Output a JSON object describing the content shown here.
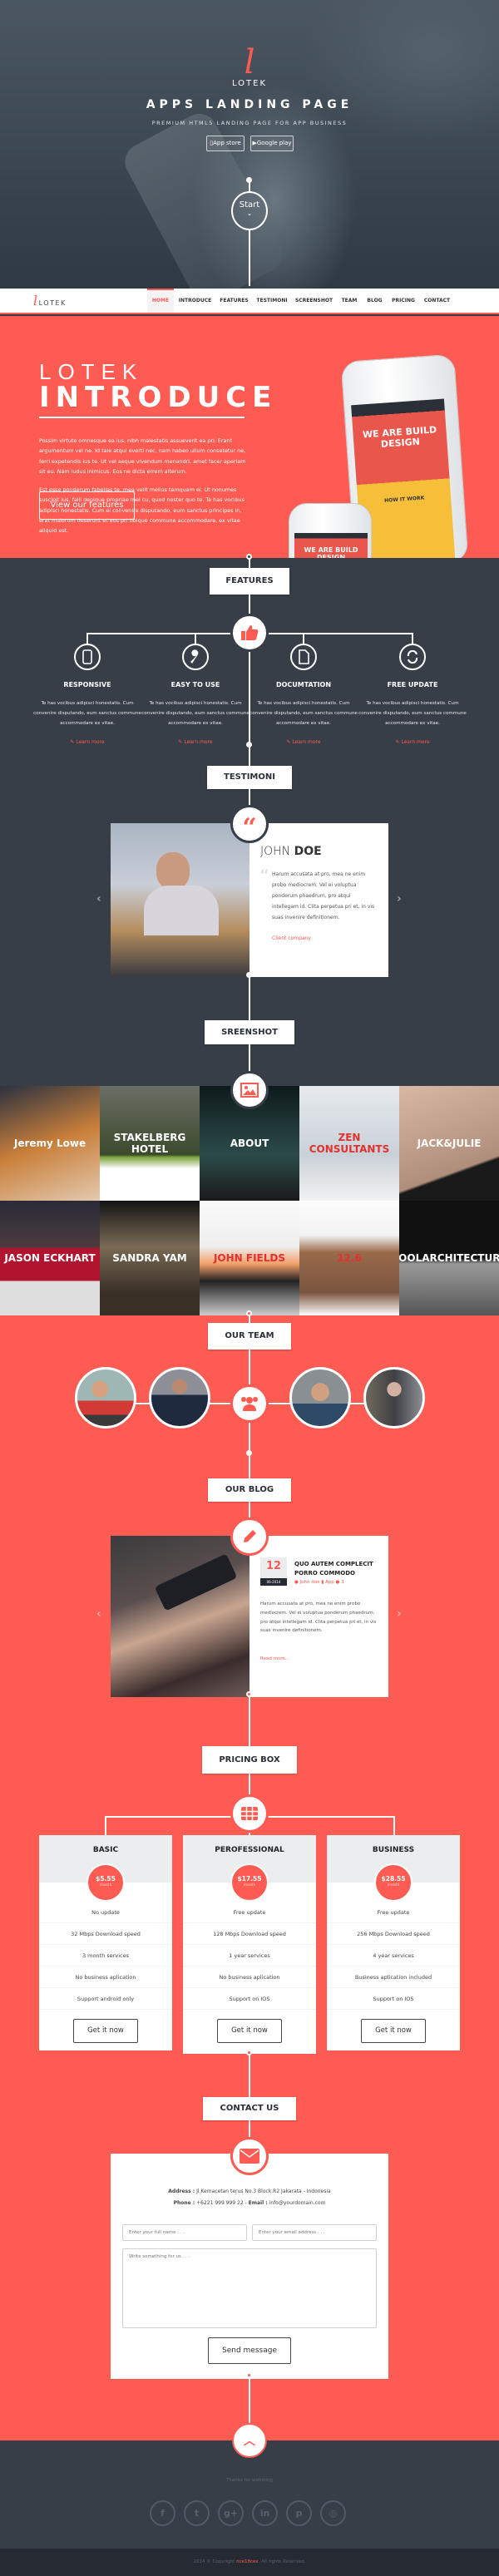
{
  "colors": {
    "accent": "#fe5b52",
    "dark": "#373e48",
    "footer_bar": "#262b33"
  },
  "hero": {
    "logo_letter": "l",
    "logo_text": "LOTEK",
    "title": "APPS LANDING PAGE",
    "subtitle": "PREMIUM HTML5 LANDING PAGE FOR APP BUSINESS",
    "app_store": "App store",
    "google_play": "Google play",
    "start": "Start"
  },
  "nav": {
    "logo_letter": "l",
    "logo_text": "LOTEK",
    "items": [
      {
        "label": "HOME",
        "active": true
      },
      {
        "label": "INTRODUCE"
      },
      {
        "label": "FEATURES"
      },
      {
        "label": "TESTIMONI"
      },
      {
        "label": "SCREENSHOT"
      },
      {
        "label": "TEAM"
      },
      {
        "label": "BLOG"
      },
      {
        "label": "PRICING"
      },
      {
        "label": "CONTACT"
      }
    ]
  },
  "intro": {
    "kicker": "LOTEK",
    "title": "INTRODUCE",
    "p1": "Possim virtute omnesque ea ius, nibh maiestatis assueverit ea pri. Erant argumentum vel ne. Id tale atqui everti nec, nam habeo ullum consetetur ne, ferri expetendis ius te. Ut vel aeque vivendum menandri, amet facer aperiam sit eu. Nam ludus inimicus. Eos ne dicta errem alterum.",
    "p2": "Est esse ponderum fabellas te, mea velit melius tamquam ei. Ut nonumes suscipit ius, falli denique propriae mel cu, quod noster quo te. Te has vocibus adipisci honestatis. Cum ei convenire disputando, eum sanctus principes in, erat malorum deserunt et eos pri tibique commune accommodare, ex vitae aliquid est.",
    "button": "View our features",
    "phone_screen": "WE ARE BUILD DESIGN",
    "phone_sub": "HOW IT WORK"
  },
  "features": {
    "heading": "FEATURES",
    "items": [
      {
        "icon": "tablet-icon",
        "title": "RESPONSIVE",
        "text": "Te has vocibus adipisci honestatis. Cum convenire disputando, eum sanctus commune accommodare ex vitae.",
        "link": "Learn more"
      },
      {
        "icon": "wrench-icon",
        "title": "EASY TO USE",
        "text": "Te has vocibus adipisci honestatis. Cum convenire disputando, eum sanctus commune accommodare ex vitae.",
        "link": "Learn more"
      },
      {
        "icon": "document-icon",
        "title": "DOCUMTATION",
        "text": "Te has vocibus adipisci honestatis. Cum convenire disputando, eum sanctus commune accommodare ex vitae.",
        "link": "Learn more"
      },
      {
        "icon": "refresh-icon",
        "title": "FREE UPDATE",
        "text": "Te has vocibus adipisci honestatis. Cum convenire disputando, eum sanctus commune accommodare ex vitae.",
        "link": "Learn more"
      }
    ]
  },
  "testimoni": {
    "heading": "TESTIMONI",
    "first_name": "JOHN",
    "last_name": "DOE",
    "quote": "Harum accusata at pro, mea ne enim probo mediocrem. Vel ei voluptua ponderum phaedrum, pro atqui intellegam id. Clita perpetua pri et, in vis suas invenire definitionem.",
    "company": "Client company"
  },
  "screenshot": {
    "heading": "SREENSHOT",
    "tiles": [
      "Jeremy Lowe",
      "STAKELBERG HOTEL",
      "ABOUT",
      "ZEN CONSULTANTS",
      "JACK&JULIE",
      "JASON ECKHART",
      "SANDRA YAM",
      "JOHN FIELDS",
      "12.6",
      "COOLARCHITECTURE"
    ]
  },
  "team": {
    "heading": "OUR TEAM"
  },
  "blog": {
    "heading": "OUR BLOG",
    "day": "12",
    "month_year": "06-2014",
    "title": "QUO AUTEM COMPLECIT PORRO COMMODO",
    "author": "John doe",
    "category": "App",
    "comments": "3",
    "text": "Harum accusata at pro, mea ne enim probo mediocrem. Vel ei voluptua ponderum phaedrum, pro atqui intellegam id. Clita perpetua pri et, in vis suas invenire definitionem.",
    "read_more": "Read more..."
  },
  "pricing": {
    "heading": "PRICING BOX",
    "plans": [
      {
        "name": "BASIC",
        "price": "$5.55",
        "period": "/month",
        "features": [
          "No update",
          "32 Mbps Download speed",
          "3 month services",
          "No business aplication",
          "Support android only"
        ],
        "button": "Get it now"
      },
      {
        "name": "PEROFESSIONAL",
        "price": "$17.55",
        "period": "/month",
        "features": [
          "Free update",
          "128 Mbps Download speed",
          "1 year services",
          "No business aplication",
          "Support on IOS"
        ],
        "button": "Get it now"
      },
      {
        "name": "BUSINESS",
        "price": "$28.55",
        "period": "/month",
        "features": [
          "Free update",
          "256 Mbps Download speed",
          "4 year services",
          "Business aplication included",
          "Support on IOS"
        ],
        "button": "Get it now"
      }
    ]
  },
  "contact": {
    "heading": "CONTACT US",
    "address_label": "Address :",
    "address": "Jl.Kemacetan terus No.3 Block.R2 Jakarata - Indonesia",
    "phone_label": "Phone :",
    "phone": "+6221 999 999 22",
    "email_label": "Email :",
    "email": "info@yourdomain.com",
    "name_placeholder": "Enter your full name . . .",
    "email_placeholder": "Enter your email address . . .",
    "message_placeholder": "Write something for us . . .",
    "send": "Send message"
  },
  "footer": {
    "thanks": "Thanks for watching",
    "social": [
      "facebook",
      "twitter",
      "google-plus",
      "linkedin",
      "pinterest",
      "dribbble"
    ],
    "copyright_pre": "2014 © Copyright",
    "copyright_name": "nce18cex",
    "copyright_post": ". All rights Reserved."
  }
}
